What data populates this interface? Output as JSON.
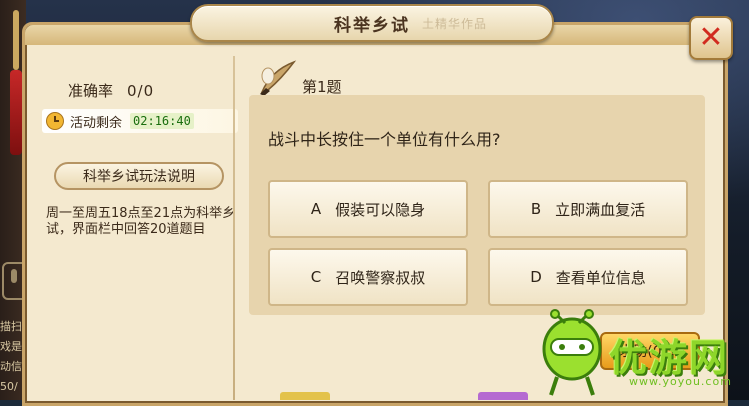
{
  "window": {
    "title": "科举乡试",
    "faded_title_text": "土精华作品",
    "close_icon": "close-x-icon"
  },
  "stats": {
    "accuracy_label": "准确率",
    "accuracy_value": "0/0",
    "timer_label": "活动剩余",
    "timer_value": "02:16:40"
  },
  "rules": {
    "title": "科举乡试玩法说明",
    "text": "周一至周五18点至21点为科举乡试，界面栏中回答20道题目"
  },
  "question": {
    "number_label": "第1题",
    "text": "战斗中长按住一个单位有什么用?",
    "answers": [
      {
        "letter": "A",
        "text": "假装可以隐身"
      },
      {
        "letter": "B",
        "text": "立即满血复活"
      },
      {
        "letter": "C",
        "text": "召唤警察叔叔"
      },
      {
        "letter": "D",
        "text": "查看单位信息"
      }
    ]
  },
  "share_button": {
    "label": "求助(0/3)"
  },
  "background_hud": {
    "left_texts": [
      "描扫",
      "戏是",
      "动信",
      "50/"
    ]
  },
  "watermark": {
    "brand": "优游网",
    "url": "www.yoyou.com"
  },
  "colors": {
    "panel": "#f4e9cf",
    "accent_red": "#d12b1f",
    "timer_green": "#1a6e0e"
  }
}
